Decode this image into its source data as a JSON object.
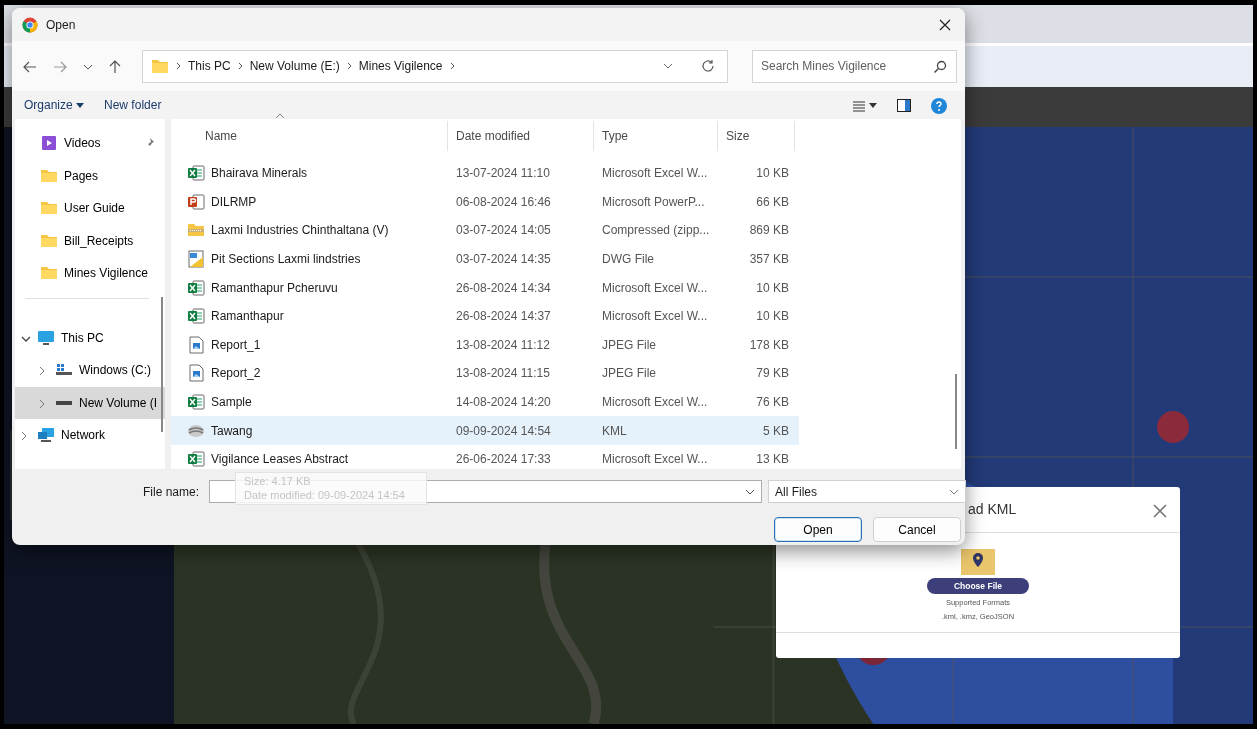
{
  "dialog": {
    "title": "Open",
    "breadcrumb": [
      "This PC",
      "New Volume (E:)",
      "Mines Vigilence"
    ],
    "search": {
      "placeholder": "Search Mines Vigilence"
    },
    "toolbar": {
      "organize": "Organize",
      "new_folder": "New folder"
    },
    "quick_access": [
      {
        "label": "Videos",
        "kind": "videos",
        "pinned": true
      },
      {
        "label": "Pages",
        "kind": "folder",
        "pinned": false
      },
      {
        "label": "User Guide",
        "kind": "folder",
        "pinned": false
      },
      {
        "label": "Bill_Receipts",
        "kind": "folder",
        "pinned": false
      },
      {
        "label": "Mines Vigilence",
        "kind": "folder",
        "pinned": false
      }
    ],
    "tree": [
      {
        "label": "This PC",
        "kind": "pc",
        "expanded": true,
        "selected": false,
        "children": [
          {
            "label": "Windows (C:)",
            "kind": "windows-drive",
            "expanded": false,
            "selected": false
          },
          {
            "label": "New Volume (I",
            "kind": "drive",
            "expanded": false,
            "selected": true
          }
        ]
      },
      {
        "label": "Network",
        "kind": "network",
        "expanded": false,
        "selected": false
      }
    ],
    "columns": [
      "Name",
      "Date modified",
      "Type",
      "Size"
    ],
    "files": [
      {
        "name": "Bhairava Minerals",
        "kind": "excel",
        "date": "13-07-2024 11:10",
        "type": "Microsoft Excel W...",
        "size": "10 KB",
        "selected": false
      },
      {
        "name": "DILRMP",
        "kind": "powerpoint",
        "date": "06-08-2024 16:46",
        "type": "Microsoft PowerP...",
        "size": "66 KB",
        "selected": false
      },
      {
        "name": "Laxmi Industries Chinthaltana (V)",
        "kind": "zip",
        "date": "03-07-2024 14:05",
        "type": "Compressed (zipp...",
        "size": "869 KB",
        "selected": false
      },
      {
        "name": "Pit Sections Laxmi lindstries",
        "kind": "dwg",
        "date": "03-07-2024 14:35",
        "type": "DWG File",
        "size": "357 KB",
        "selected": false
      },
      {
        "name": "Ramanthapur Pcheruvu",
        "kind": "excel",
        "date": "26-08-2024 14:34",
        "type": "Microsoft Excel W...",
        "size": "10 KB",
        "selected": false
      },
      {
        "name": "Ramanthapur",
        "kind": "excel",
        "date": "26-08-2024 14:37",
        "type": "Microsoft Excel W...",
        "size": "10 KB",
        "selected": false
      },
      {
        "name": "Report_1",
        "kind": "jpeg",
        "date": "13-08-2024 11:12",
        "type": "JPEG File",
        "size": "178 KB",
        "selected": false
      },
      {
        "name": "Report_2",
        "kind": "jpeg",
        "date": "13-08-2024 11:15",
        "type": "JPEG File",
        "size": "79 KB",
        "selected": false
      },
      {
        "name": "Sample",
        "kind": "excel",
        "date": "14-08-2024 14:20",
        "type": "Microsoft Excel W...",
        "size": "76 KB",
        "selected": false
      },
      {
        "name": "Tawang",
        "kind": "kml",
        "date": "09-09-2024 14:54",
        "type": "KML",
        "size": "5 KB",
        "selected": true
      },
      {
        "name": "Vigilance Leases Abstract",
        "kind": "excel",
        "date": "26-06-2024 17:33",
        "type": "Microsoft Excel W...",
        "size": "13 KB",
        "selected": false
      }
    ],
    "tooltip": [
      "Size: 4.17 KB",
      "Date modified: 09-09-2024 14:54"
    ],
    "file_name_label": "File name:",
    "file_type": "All Files",
    "buttons": [
      {
        "label": "Open",
        "default": true
      },
      {
        "label": "Cancel",
        "default": false
      }
    ]
  },
  "kml_modal": {
    "title": "ad KML",
    "button": "Choose File",
    "formats_label": "Supported Formats",
    "formats": ".kml, .kmz, GeoJSON"
  }
}
